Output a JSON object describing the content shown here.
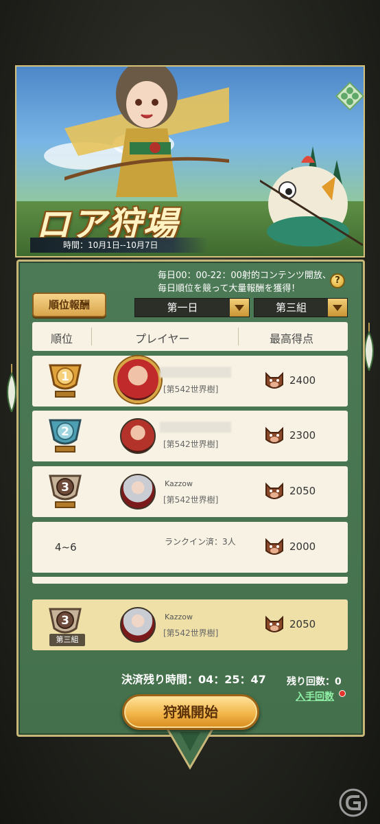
{
  "event": {
    "title": "ロア狩場",
    "period": "時間：10月1日--10月7日"
  },
  "panel": {
    "description": "毎日00：00-22：00射的コンテンツ開放、毎日順位を競って大量報酬を獲得！",
    "help_label": "?",
    "reward_button": "順位報酬",
    "day_select": "第一日",
    "group_select": "第三組"
  },
  "table": {
    "headers": [
      "順位",
      "プレイヤー",
      "最高得点"
    ],
    "rows": [
      {
        "rank": "1",
        "name": "",
        "server": "[第542世界樹]",
        "score": "2400"
      },
      {
        "rank": "2",
        "name": "",
        "server": "[第542世界樹]",
        "score": "2300"
      },
      {
        "rank": "3",
        "name": "Kazzow",
        "server": "[第542世界樹]",
        "score": "2050"
      },
      {
        "rank": "4~6",
        "ranked_text": "ランクイン済：3人",
        "score": "2000"
      }
    ],
    "my_row": {
      "rank": "3",
      "group": "第三組",
      "name": "Kazzow",
      "server": "[第542世界樹]",
      "score": "2050"
    }
  },
  "footer": {
    "countdown": "決済残り時間：04：25：47",
    "remaining": "残り回数：0",
    "get_count": "入手回数",
    "start_button": "狩猟開始"
  },
  "colors": {
    "panel_green": "#4d7a56",
    "gold": "#c9b779",
    "row_bg": "#f7f2e3",
    "my_row_bg": "#efe0a8",
    "link_green": "#8ff0a6"
  }
}
